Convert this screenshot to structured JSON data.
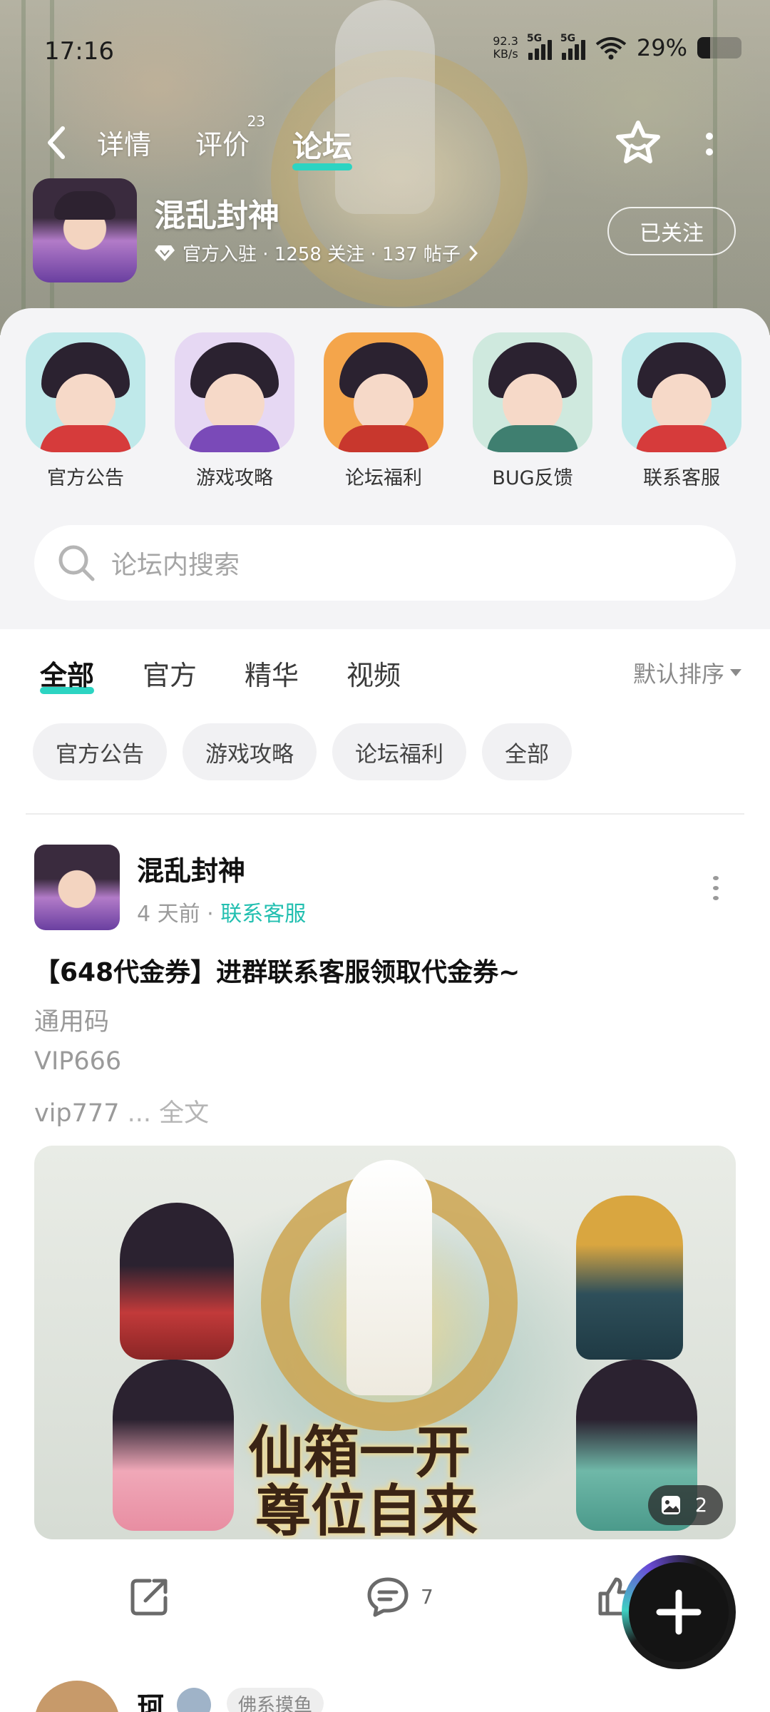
{
  "status_bar": {
    "time": "17:16",
    "net_speed_value": "92.3",
    "net_speed_unit": "KB/s",
    "signal1_label": "5G",
    "signal2_label": "5G",
    "battery_text": "29%",
    "battery_level": 0.29
  },
  "nav": {
    "tabs": [
      {
        "label": "详情"
      },
      {
        "label": "评价",
        "badge": "23"
      },
      {
        "label": "论坛"
      }
    ],
    "active_tab": "论坛"
  },
  "game": {
    "title": "混乱封神",
    "meta": "官方入驻 · 1258 关注 · 137 帖子",
    "follow_label": "已关注"
  },
  "categories": [
    {
      "label": "官方公告",
      "bg": "#bfe9ea"
    },
    {
      "label": "游戏攻略",
      "bg": "#e6d8f3"
    },
    {
      "label": "论坛福利",
      "bg": "#f4a54b"
    },
    {
      "label": "BUG反馈",
      "bg": "#cfe9de"
    },
    {
      "label": "联系客服",
      "bg": "#bfe9ea"
    }
  ],
  "search": {
    "placeholder": "论坛内搜索"
  },
  "filters": {
    "tabs": [
      {
        "label": "全部"
      },
      {
        "label": "官方"
      },
      {
        "label": "精华"
      },
      {
        "label": "视频"
      }
    ],
    "active": "全部",
    "sort_label": "默认排序",
    "chips": [
      {
        "label": "官方公告"
      },
      {
        "label": "游戏攻略"
      },
      {
        "label": "论坛福利"
      },
      {
        "label": "全部"
      }
    ]
  },
  "post": {
    "author": "混乱封神",
    "time": "4 天前",
    "category": "联系客服",
    "title": "【648代金券】进群联系客服领取代金券~",
    "lines": [
      "通用码",
      "VIP666",
      "vip777"
    ],
    "ellipsis": " ... ",
    "read_more": "全文",
    "image_caption_line1": "仙箱一开",
    "image_caption_line2": "尊位自来",
    "image_count": "2",
    "comment_count": "7"
  },
  "next_post": {
    "author": "珂",
    "tag": "佛系摸鱼"
  },
  "colors": {
    "accent": "#2cd4c2",
    "link": "#22bfb0"
  }
}
